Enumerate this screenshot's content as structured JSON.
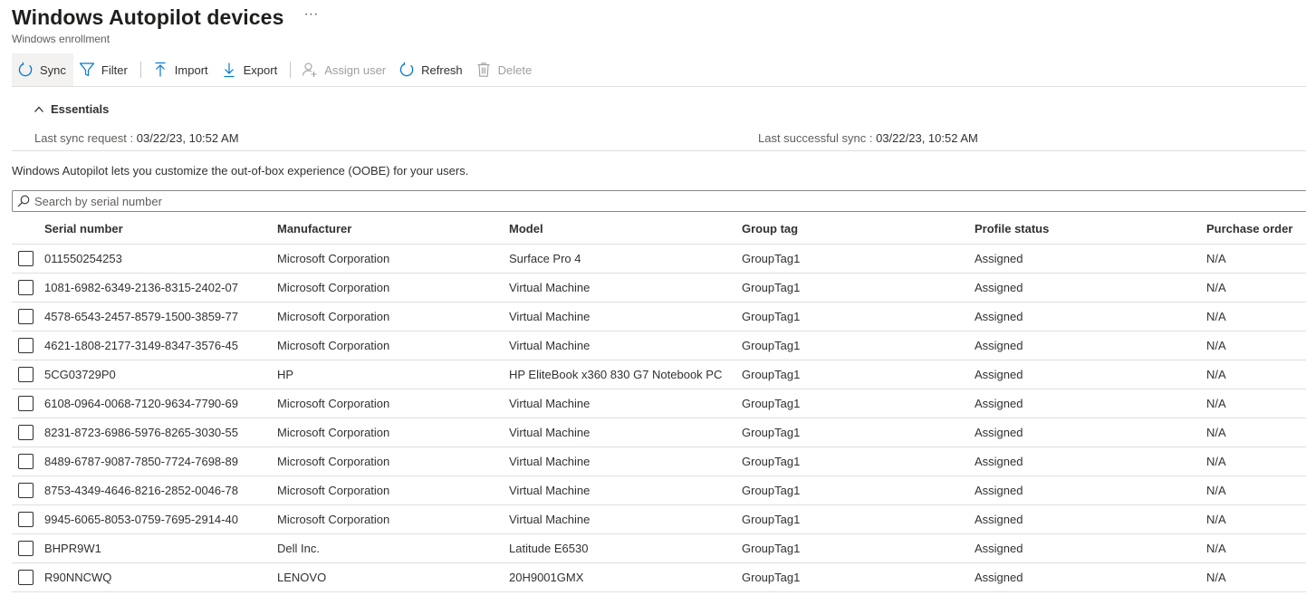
{
  "header": {
    "title": "Windows Autopilot devices",
    "more": "···",
    "subtitle": "Windows enrollment"
  },
  "toolbar": {
    "sync": "Sync",
    "filter": "Filter",
    "import": "Import",
    "export": "Export",
    "assign_user": "Assign user",
    "refresh": "Refresh",
    "delete": "Delete"
  },
  "essentials": {
    "label": "Essentials",
    "last_sync_request_label": "Last sync request",
    "last_sync_request_value": "03/22/23, 10:52 AM",
    "last_successful_sync_label": "Last successful sync",
    "last_successful_sync_value": "03/22/23, 10:52 AM",
    "separator": ":"
  },
  "intro": "Windows Autopilot lets you customize the out-of-box experience (OOBE) for your users.",
  "search": {
    "placeholder": "Search by serial number"
  },
  "table": {
    "columns": [
      "Serial number",
      "Manufacturer",
      "Model",
      "Group tag",
      "Profile status",
      "Purchase order"
    ],
    "rows": [
      [
        "011550254253",
        "Microsoft Corporation",
        "Surface Pro 4",
        "GroupTag1",
        "Assigned",
        "N/A"
      ],
      [
        "1081-6982-6349-2136-8315-2402-07",
        "Microsoft Corporation",
        "Virtual Machine",
        "GroupTag1",
        "Assigned",
        "N/A"
      ],
      [
        "4578-6543-2457-8579-1500-3859-77",
        "Microsoft Corporation",
        "Virtual Machine",
        "GroupTag1",
        "Assigned",
        "N/A"
      ],
      [
        "4621-1808-2177-3149-8347-3576-45",
        "Microsoft Corporation",
        "Virtual Machine",
        "GroupTag1",
        "Assigned",
        "N/A"
      ],
      [
        "5CG03729P0",
        "HP",
        "HP EliteBook x360 830 G7 Notebook PC",
        "GroupTag1",
        "Assigned",
        "N/A"
      ],
      [
        "6108-0964-0068-7120-9634-7790-69",
        "Microsoft Corporation",
        "Virtual Machine",
        "GroupTag1",
        "Assigned",
        "N/A"
      ],
      [
        "8231-8723-6986-5976-8265-3030-55",
        "Microsoft Corporation",
        "Virtual Machine",
        "GroupTag1",
        "Assigned",
        "N/A"
      ],
      [
        "8489-6787-9087-7850-7724-7698-89",
        "Microsoft Corporation",
        "Virtual Machine",
        "GroupTag1",
        "Assigned",
        "N/A"
      ],
      [
        "8753-4349-4646-8216-2852-0046-78",
        "Microsoft Corporation",
        "Virtual Machine",
        "GroupTag1",
        "Assigned",
        "N/A"
      ],
      [
        "9945-6065-8053-0759-7695-2914-40",
        "Microsoft Corporation",
        "Virtual Machine",
        "GroupTag1",
        "Assigned",
        "N/A"
      ],
      [
        "BHPR9W1",
        "Dell Inc.",
        "Latitude E6530",
        "GroupTag1",
        "Assigned",
        "N/A"
      ],
      [
        "R90NNCWQ",
        "LENOVO",
        "20H9001GMX",
        "GroupTag1",
        "Assigned",
        "N/A"
      ]
    ]
  },
  "colors": {
    "accent": "#0078d4",
    "text": "#323130",
    "muted": "#605e5c",
    "disabled": "#a19f9d",
    "border": "#e1dfdd"
  }
}
